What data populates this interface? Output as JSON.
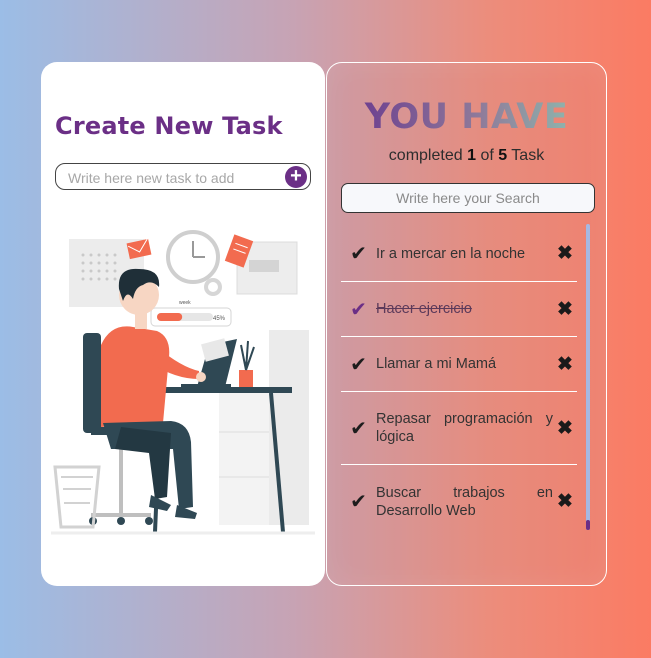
{
  "create_panel": {
    "title": "Create New Task",
    "input_placeholder": "Write here new task to add",
    "add_button_label": "+"
  },
  "illustration": {
    "clock_tag": "week",
    "progress_label": "45%",
    "progress_value": 0.45
  },
  "summary_panel": {
    "headline": "YOU HAVE",
    "completed_prefix": "completed",
    "completed_count": "1",
    "of_word": "of",
    "total_count": "5",
    "task_word": "Task",
    "search_placeholder": "Write here your Search"
  },
  "tasks": [
    {
      "text": "Ir a mercar en la noche",
      "done": false
    },
    {
      "text": "Hacer ejercicio",
      "done": true
    },
    {
      "text": "Llamar a mi Mamá",
      "done": false
    },
    {
      "text": "Repasar programación y lógica",
      "done": false
    },
    {
      "text": "Buscar trabajos en Desarrollo Web",
      "done": false
    }
  ],
  "icons": {
    "check": "check-icon",
    "delete": "close-icon",
    "add": "plus-icon"
  },
  "colors": {
    "accent": "#6b2f86",
    "bg_left": "#9bbde6",
    "bg_right": "#fb7b63",
    "illustration_orange": "#f26b4f"
  }
}
